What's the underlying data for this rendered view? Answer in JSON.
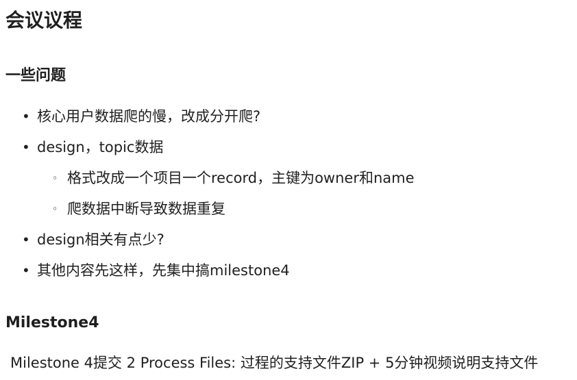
{
  "title": "会议议程",
  "section1": {
    "heading": "一些问题",
    "items": [
      "核心用户数据爬的慢，改成分开爬?",
      "design，topic数据",
      "design相关有点少?",
      "其他内容先这样，先集中搞milestone4"
    ],
    "subitems": [
      "格式改成一个项目一个record，主键为owner和name",
      "爬数据中断导致数据重复"
    ]
  },
  "section2": {
    "heading": "Milestone4",
    "paragraph": "Milestone 4提交 2 Process Files: 过程的支持文件ZIP + 5分钟视频说明支持文件"
  }
}
